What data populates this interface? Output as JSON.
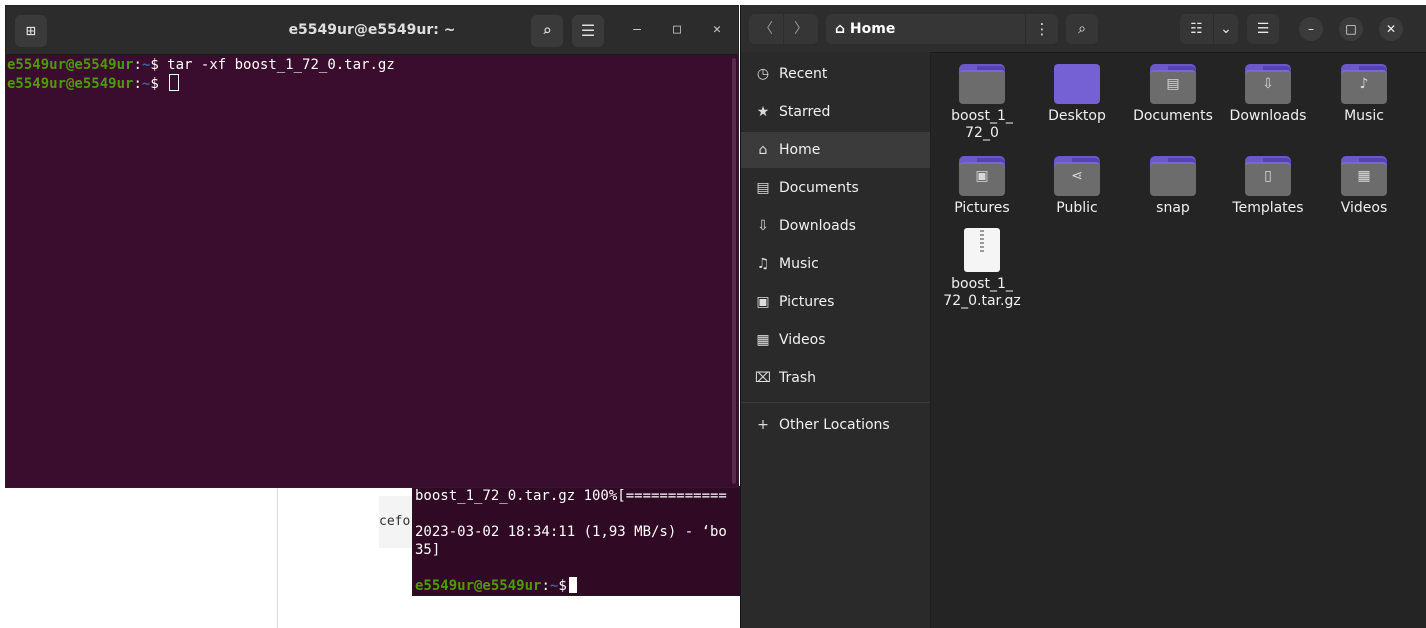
{
  "background": {
    "code_snippet": "cefo"
  },
  "terminal_back": {
    "lines": [
      "boost_1_72_0.tar.gz 100%[============",
      "",
      "2023-03-02 18:34:11 (1,93 MB/s) - ‘bo",
      "35]"
    ],
    "prompt_user": "e5549ur@e5549ur",
    "prompt_path": "~",
    "prompt_symbol": "$"
  },
  "terminal": {
    "title": "e5549ur@e5549ur: ~",
    "new_tab_icon": "new-tab-icon",
    "search_icon": "search-icon",
    "menu_icon": "hamburger-menu-icon",
    "prompt_user": "e5549ur@e5549ur",
    "prompt_sep": ":",
    "prompt_path": "~",
    "prompt_symbol": "$ ",
    "command1": "tar -xf boost_1_72_0.tar.gz",
    "min_label": "–",
    "max_label": "□",
    "close_label": "✕"
  },
  "file_manager": {
    "path_label": "Home",
    "back_label": "〈",
    "forward_label": "〉",
    "sidebar": [
      {
        "label": "Recent",
        "icon": "clock-icon",
        "glyph": "◷"
      },
      {
        "label": "Starred",
        "icon": "star-icon",
        "glyph": "★"
      },
      {
        "label": "Home",
        "icon": "home-icon",
        "glyph": "⌂",
        "active": true
      },
      {
        "label": "Documents",
        "icon": "document-icon",
        "glyph": "▤"
      },
      {
        "label": "Downloads",
        "icon": "download-icon",
        "glyph": "⇩"
      },
      {
        "label": "Music",
        "icon": "music-icon",
        "glyph": "♫"
      },
      {
        "label": "Pictures",
        "icon": "picture-icon",
        "glyph": "▣"
      },
      {
        "label": "Videos",
        "icon": "video-icon",
        "glyph": "▦"
      },
      {
        "label": "Trash",
        "icon": "trash-icon",
        "glyph": "⌧"
      }
    ],
    "other_locations": {
      "label": "Other Locations",
      "glyph": "+"
    },
    "items": [
      {
        "line1": "boost_1_",
        "line2": "72_0",
        "type": "folder",
        "glyph": ""
      },
      {
        "line1": "Desktop",
        "line2": "",
        "type": "desktop",
        "glyph": ""
      },
      {
        "line1": "Documents",
        "line2": "",
        "type": "folder",
        "glyph": "▤"
      },
      {
        "line1": "Downloads",
        "line2": "",
        "type": "folder",
        "glyph": "⇩"
      },
      {
        "line1": "Music",
        "line2": "",
        "type": "folder",
        "glyph": "♪"
      },
      {
        "line1": "Pictures",
        "line2": "",
        "type": "folder",
        "glyph": "▣"
      },
      {
        "line1": "Public",
        "line2": "",
        "type": "folder",
        "glyph": "⋖"
      },
      {
        "line1": "snap",
        "line2": "",
        "type": "folder",
        "glyph": ""
      },
      {
        "line1": "Templates",
        "line2": "",
        "type": "folder",
        "glyph": "▯"
      },
      {
        "line1": "Videos",
        "line2": "",
        "type": "folder",
        "glyph": "▦"
      },
      {
        "line1": "boost_1_",
        "line2": "72_0.tar.gz",
        "type": "archive",
        "glyph": ""
      }
    ],
    "colors": {
      "folder_accent": "#6d58c9",
      "sidebar_bg": "#2a2a2a"
    }
  }
}
